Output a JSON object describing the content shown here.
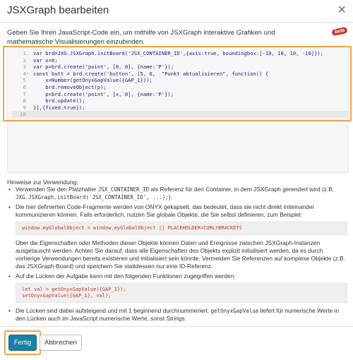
{
  "dialog": {
    "title": "JSXGraph bearbeiten",
    "close_label": "×",
    "intro": "Geben Sie Ihren JavaScript-Code ein, um mithilfe von JSXGraph interaktive Grafiken und mathematische Visualisierungen einzubinden.",
    "beta_label": "beta"
  },
  "editor": {
    "lines": [
      {
        "num": "1",
        "fold": "",
        "code": "var brd=JXG.JSXGraph.initBoard('JSX_CONTAINER_ID',{axis:true, boundingbox:[-10, 10, 10, -10]});"
      },
      {
        "num": "2",
        "fold": "",
        "code": "var x=0;"
      },
      {
        "num": "3",
        "fold": "",
        "code": "var p=brd.create('point', [0, 0], {name:'P'});"
      },
      {
        "num": "4",
        "fold": "▾",
        "code": "const butt = brd.create('button', [5, 0,  \"Punkt aktualisieren\", function() {"
      },
      {
        "num": "5",
        "fold": "",
        "code": "    x=Number(getOnyxGapValue({GAP_1}));"
      },
      {
        "num": "6",
        "fold": "",
        "code": "    brd.removeObject(p);"
      },
      {
        "num": "7",
        "fold": "",
        "code": "    p=brd.create('point', [x, 0], {name:'P'});"
      },
      {
        "num": "8",
        "fold": "",
        "code": "    brd.update();"
      },
      {
        "num": "9",
        "fold": "",
        "code": "}],{fixed:true});"
      },
      {
        "num": "10",
        "fold": "",
        "code": ""
      }
    ]
  },
  "hints": {
    "title": "Hinweise zur Verwendung:",
    "item1_a": "Verwenden Sie den Platzhalter ",
    "item1_code1": "JSX_CONTAINER_ID",
    "item1_b": " als Referenz für den Container, in dem JSXGraph gerendert wird (z.B. ",
    "item1_code2": "JXG.JSXGraph.initBoard('JSX_CONTAINER_ID', ...);",
    "item1_c": ").",
    "item2": "Die hier definierten Code-Fragmente werden von ONYX gekapselt, das bedeutet, dass sie nicht direkt miteinander kommunizieren können. Falls erforderlich, nutzen Sie globale Objekte, die Sie selbst definieren, zum Beispiel:",
    "code_global": "window.myGlobalObject = window.myGlobalObject || PLACEHOLDER=CURLYBRACKETS",
    "para_props": "Über die Eigenschaften oder Methoden dieser Objekte können Daten und Ereignisse zwischen JSXGraph-Instanzen ausgetauscht werden. Achten Sie darauf, dass alle Eigenschaften des Objekts explizit initialisiert werden, da es durch vorherige Verwendungen bereits existieren und initialisiert sein könnte. Vermeiden Sie Referenzen auf komplexe Objekte (z.B. das JSXGraph-Board) und speichern Sie stattdessen nur eine ID-Referenz.",
    "item3": "Auf die Lücken der Aufgabe kann mit den folgenden Funktionen zugegriffen werden:",
    "code_gap": "let val = getOnyxGapValue({GAP_1});\nsetOnyxGapValue({GAP_1}, val);",
    "item4_a": "Die Lücken sind dabei aufsteigend und mit 1 beginnend durchnummeriert. ",
    "item4_code": "getOnyxGapValue",
    "item4_b": " liefert für numerische Werte in den Lücken auch im JavaScript numerische Werte, sonst Strings."
  },
  "footer": {
    "done_label": "Fertig",
    "cancel_label": "Abbrechen"
  },
  "colors": {
    "primary": "#1d7fa5",
    "focus_ring": "#f0a24a",
    "code_red": "#c0392b"
  }
}
